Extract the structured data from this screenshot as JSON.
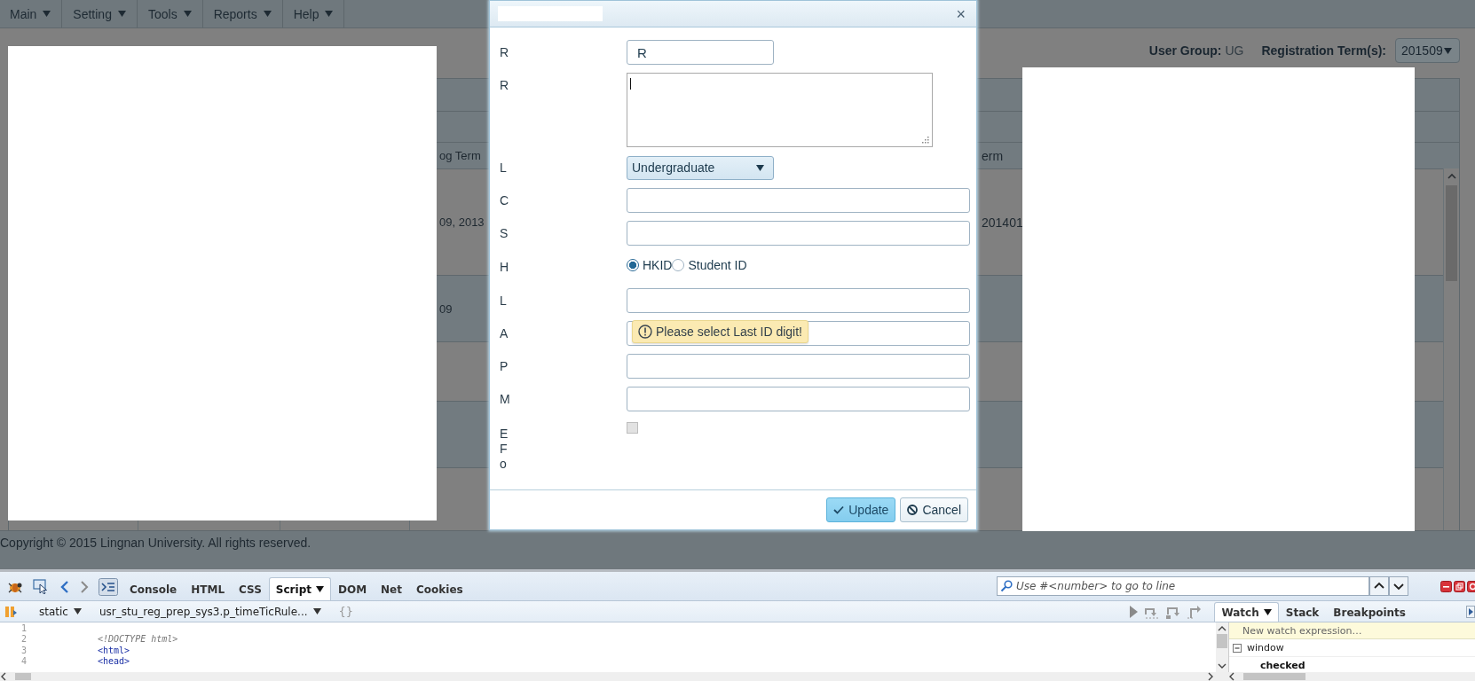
{
  "menu": [
    {
      "label": "Main"
    },
    {
      "label": "Setting"
    },
    {
      "label": "Tools"
    },
    {
      "label": "Reports"
    },
    {
      "label": "Help"
    }
  ],
  "filters": {
    "user_group_label": "User Group:",
    "user_group": "UG",
    "term_label": "Registration Term(s):",
    "term": "201509"
  },
  "table": {
    "header": {
      "column_4": "og Term",
      "column_5": "erm"
    },
    "rows": [
      {
        "column_4": "09, 2013",
        "column_5": "201401"
      },
      {
        "column_4": "09"
      }
    ]
  },
  "footer": "Copyright © 2015 Lingnan University. All rights reserved.",
  "dialog": {
    "close": "×",
    "fields": [
      {
        "kind": "short-text",
        "label": "R",
        "value": "R"
      },
      {
        "kind": "textarea",
        "label": "R"
      },
      {
        "kind": "select",
        "label": "L",
        "value": "Undergraduate"
      },
      {
        "kind": "text",
        "label": "C"
      },
      {
        "kind": "text",
        "label": "S"
      },
      {
        "kind": "radio",
        "label": "H",
        "options": [
          {
            "label": "HKID",
            "selected": true
          },
          {
            "label": "Student ID",
            "selected": false
          }
        ]
      },
      {
        "kind": "text",
        "label": "L",
        "tooltip": "Please select Last ID digit!"
      },
      {
        "kind": "text",
        "label": "A"
      },
      {
        "kind": "text",
        "label": "P"
      },
      {
        "kind": "text",
        "label": "M"
      },
      {
        "kind": "checkbox",
        "label_lines": [
          "E",
          "F",
          "o"
        ],
        "checked": false,
        "disabled": true
      }
    ],
    "buttons": [
      {
        "kind": "confirm",
        "label": "Update"
      },
      {
        "kind": "cancel",
        "label": "Cancel"
      }
    ]
  },
  "devtools": {
    "tabs": [
      {
        "label": "Console",
        "selected": false
      },
      {
        "label": "HTML",
        "selected": false
      },
      {
        "label": "CSS",
        "selected": false
      },
      {
        "label": "Script",
        "selected": true,
        "menu": true
      },
      {
        "label": "DOM",
        "selected": false
      },
      {
        "label": "Net",
        "selected": false
      },
      {
        "label": "Cookies",
        "selected": false
      }
    ],
    "search": {
      "placeholder": "Use #<number> to go to line"
    },
    "script_bar": {
      "mode": "static",
      "file": "usr_stu_reg_prep_sys3.p_timeTicRule...",
      "pretty": "{}"
    },
    "code_lines": [
      {
        "number": "1"
      },
      {
        "number": "2",
        "kind": "doctype",
        "code": "<!DOCTYPE html>"
      },
      {
        "number": "3",
        "kind": "tag",
        "code": "<html>"
      },
      {
        "number": "4",
        "kind": "tag",
        "code": "<head>"
      }
    ],
    "side_tabs": [
      {
        "label": "Watch",
        "selected": true,
        "menu": true
      },
      {
        "label": "Stack",
        "selected": false
      },
      {
        "label": "Breakpoints",
        "selected": false
      }
    ],
    "watch": {
      "placeholder": "New watch expression…",
      "items": [
        {
          "label": "window",
          "expanded": true,
          "children": [
            {
              "label": "checked"
            }
          ]
        }
      ]
    }
  }
}
